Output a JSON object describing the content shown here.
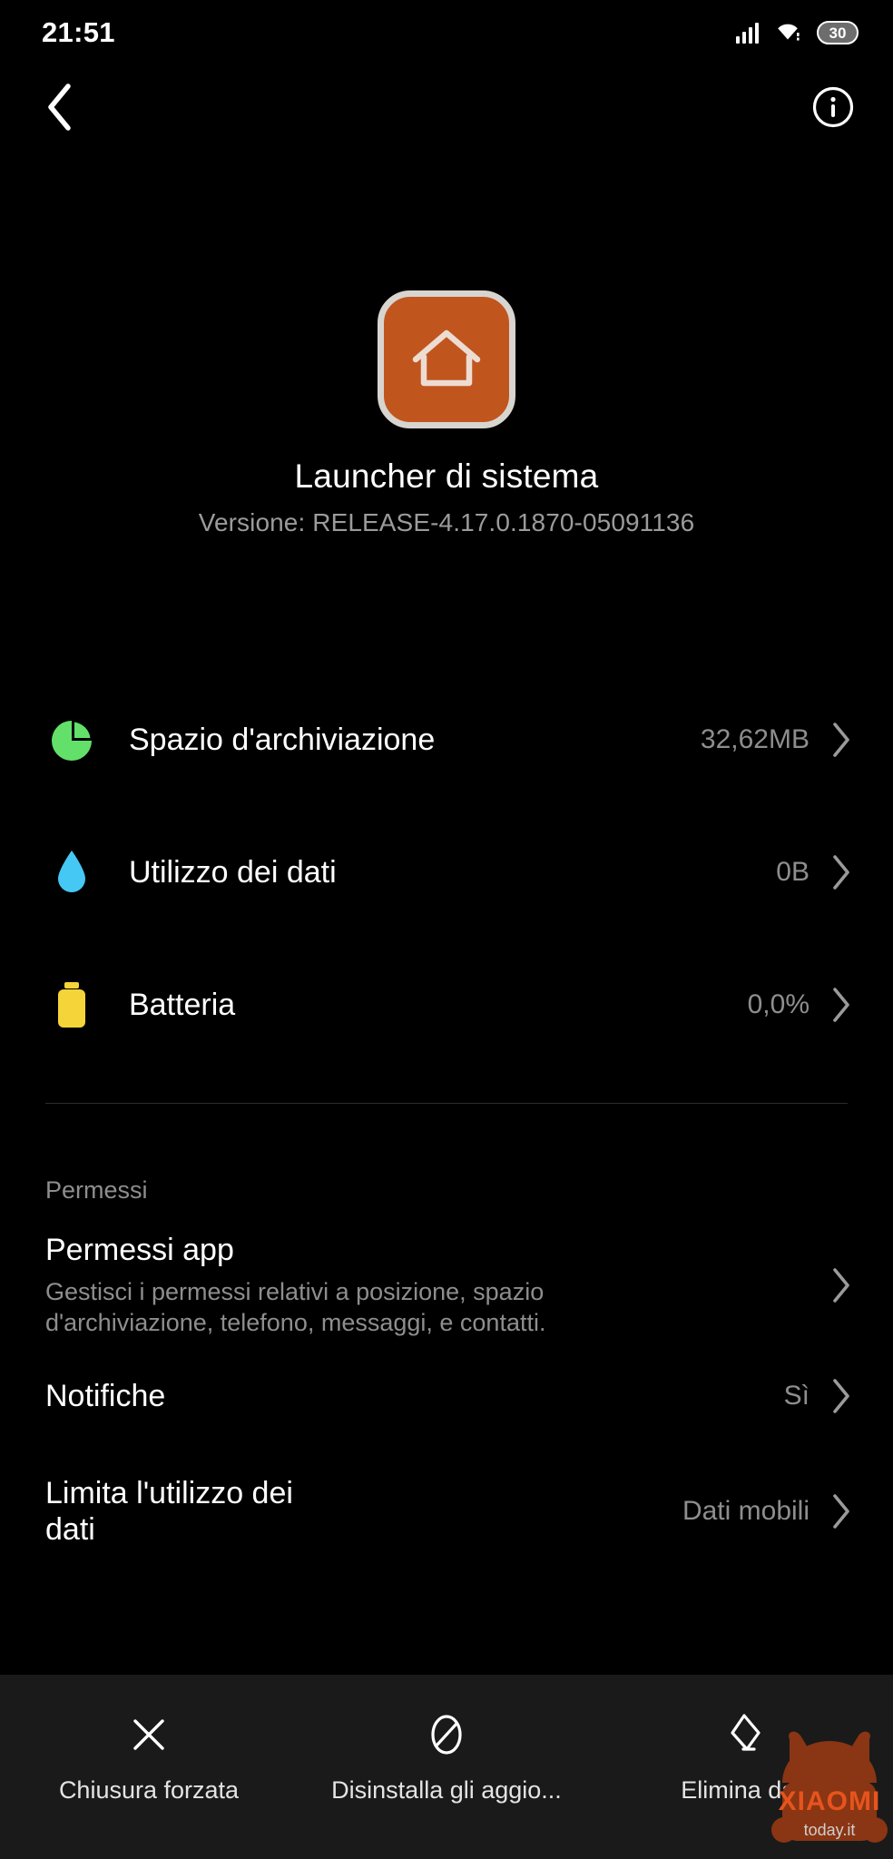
{
  "status_bar": {
    "time": "21:51",
    "battery_level": "30",
    "signal_icon": "signal-bars-icon",
    "wifi_icon": "wifi-icon",
    "battery_icon": "battery-icon"
  },
  "toolbar": {
    "back_icon": "chevron-left-icon",
    "info_icon": "info-circle-icon"
  },
  "app_header": {
    "icon": "home-app-icon",
    "icon_color": "#c1551e",
    "icon_border_color": "#d8d5d0",
    "title": "Launcher di sistema",
    "version": "Versione: RELEASE-4.17.0.1870-05091136"
  },
  "info_rows": [
    {
      "icon": "storage-pie-icon",
      "icon_color": "#63e06a",
      "label": "Spazio d'archiviazione",
      "value": "32,62MB"
    },
    {
      "icon": "data-drop-icon",
      "icon_color": "#46c8f5",
      "label": "Utilizzo dei dati",
      "value": "0B"
    },
    {
      "icon": "battery-icon",
      "icon_color": "#f5d43a",
      "label": "Batteria",
      "value": "0,0%"
    }
  ],
  "permissions": {
    "section_label": "Permessi",
    "rows": [
      {
        "title": "Permessi app",
        "description": "Gestisci i permessi relativi a posizione, spazio d'archiviazione, telefono, messaggi, e contatti.",
        "value": ""
      },
      {
        "title": "Notifiche",
        "description": "",
        "value": "Sì"
      },
      {
        "title": "Limita l'utilizzo dei dati",
        "description": "",
        "value": "Dati mobili"
      }
    ]
  },
  "action_bar": [
    {
      "icon": "close-x-icon",
      "label": "Chiusura forzata"
    },
    {
      "icon": "block-circle-slash-icon",
      "label": "Disinstalla gli aggio..."
    },
    {
      "icon": "eraser-icon",
      "label": "Elimina dati"
    }
  ],
  "watermark": {
    "brand": "XIAOMI",
    "site": "today.it",
    "color": "#8a3513"
  }
}
